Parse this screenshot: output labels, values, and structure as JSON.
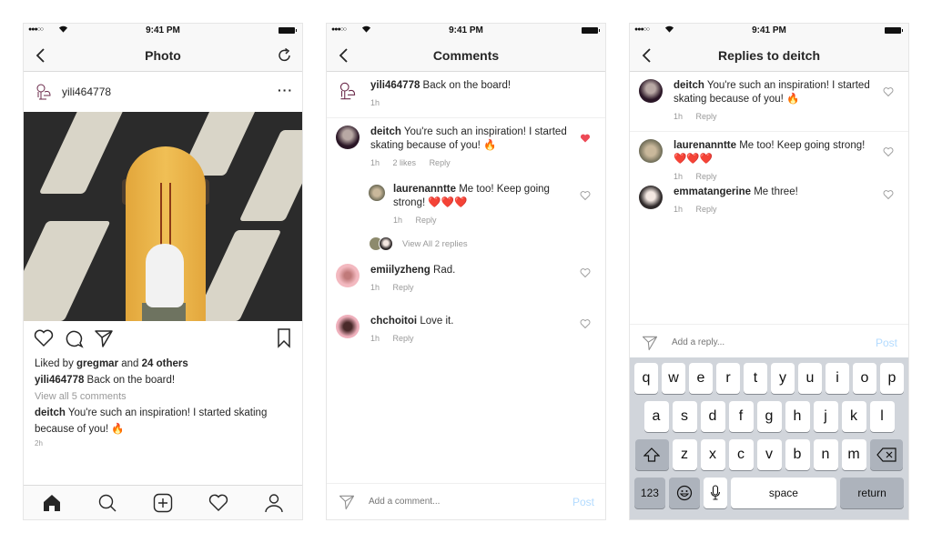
{
  "status_bar": {
    "signal": "●●●○○",
    "wifi_icon": "wifi-icon",
    "time": "9:41 PM",
    "battery_icon": "battery-icon"
  },
  "photo_screen": {
    "nav_title": "Photo",
    "author": "yili464778",
    "more_label": "···",
    "likes_prefix": "Liked by ",
    "likes_user": "gregmar",
    "likes_and": " and ",
    "likes_others": "24 others",
    "caption_user": "yili464778",
    "caption_text": " Back on the board!",
    "view_all": "View all 5 comments",
    "preview_user": "deitch",
    "preview_text": " You're such an inspiration! I started skating because of you! 🔥",
    "timestamp": "2h",
    "tabs": [
      "home",
      "search",
      "add",
      "activity",
      "profile"
    ]
  },
  "comments_screen": {
    "nav_title": "Comments",
    "caption": {
      "user": "yili464778",
      "text": " Back on the board!",
      "time": "1h"
    },
    "comments": [
      {
        "user": "deitch",
        "text": " You're such an inspiration! I started skating because of you! 🔥",
        "time": "1h",
        "likes": "2 likes",
        "reply": "Reply",
        "liked": true
      },
      {
        "user": "laurenanntte",
        "text": " Me too! Keep going strong! ❤️❤️❤️",
        "time": "1h",
        "reply": "Reply",
        "liked": false
      },
      {
        "user": "emiilyzheng",
        "text": " Rad.",
        "time": "1h",
        "reply": "Reply",
        "liked": false
      },
      {
        "user": "chchoitoi",
        "text": " Love it.",
        "time": "1h",
        "reply": "Reply",
        "liked": false
      }
    ],
    "view_replies": "View All 2 replies",
    "compose_placeholder": "Add a comment...",
    "post_label": "Post"
  },
  "replies_screen": {
    "nav_title": "Replies to deitch",
    "replies": [
      {
        "user": "deitch",
        "text": "  You're such an inspiration! I started skating because of you! 🔥",
        "time": "1h",
        "reply": "Reply"
      },
      {
        "user": "laurenanntte",
        "text": " Me too! Keep going strong! ❤️❤️❤️",
        "time": "1h",
        "reply": "Reply"
      },
      {
        "user": "emmatangerine",
        "text": " Me three!",
        "time": "1h",
        "reply": "Reply"
      }
    ],
    "compose_placeholder": "Add a reply...",
    "post_label": "Post"
  },
  "keyboard": {
    "row1": [
      "q",
      "w",
      "e",
      "r",
      "t",
      "y",
      "u",
      "i",
      "o",
      "p"
    ],
    "row2": [
      "a",
      "s",
      "d",
      "f",
      "g",
      "h",
      "j",
      "k",
      "l"
    ],
    "row3": [
      "z",
      "x",
      "c",
      "v",
      "b",
      "n",
      "m"
    ],
    "num_label": "123",
    "space_label": "space",
    "return_label": "return"
  },
  "colors": {
    "like_red": "#ed4956",
    "post_blue": "#b3dbff",
    "muted": "#999999"
  }
}
